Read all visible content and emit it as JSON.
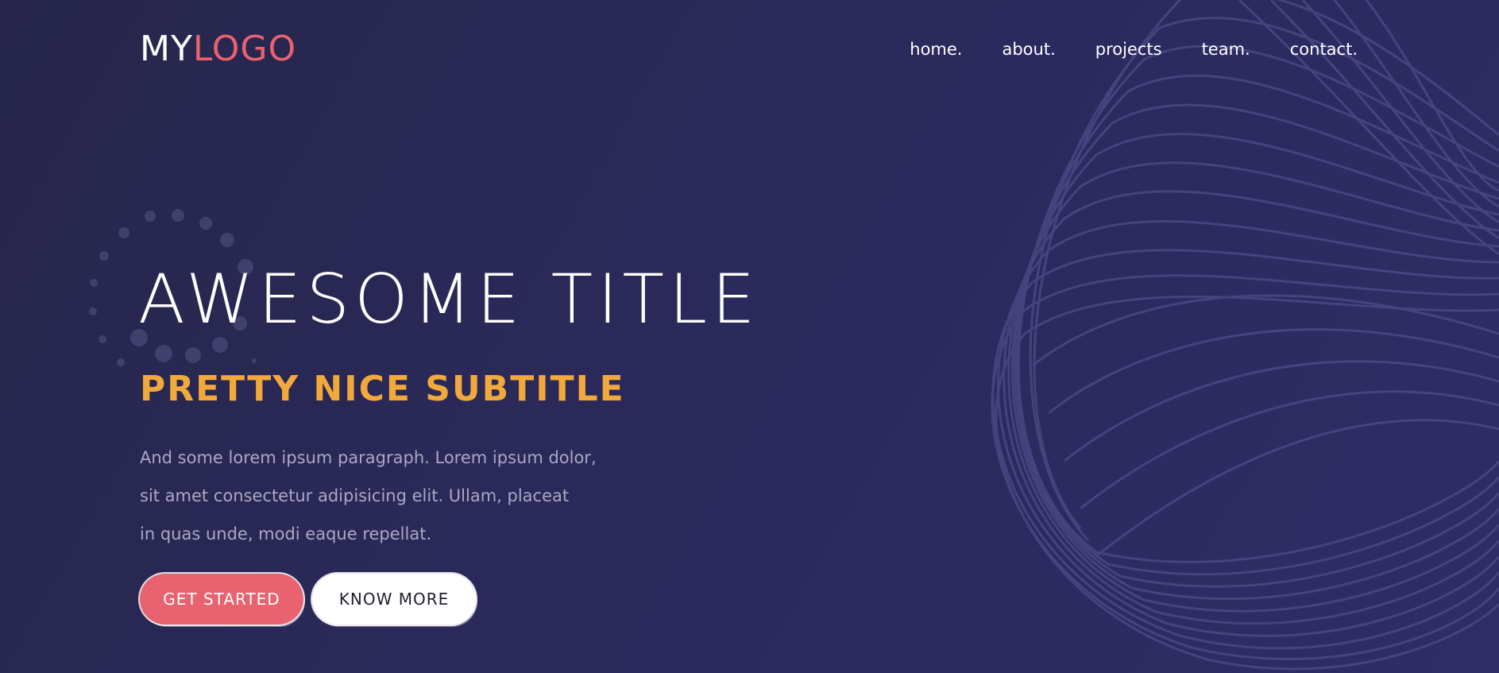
{
  "logo": {
    "part1": "MY",
    "part2": "LOGO"
  },
  "nav": [
    {
      "label": "home."
    },
    {
      "label": "about."
    },
    {
      "label": "projects"
    },
    {
      "label": "team."
    },
    {
      "label": "contact."
    }
  ],
  "hero": {
    "title": "AWESOME TITLE",
    "subtitle": "PRETTY NICE SUBTITLE",
    "paragraph_lines": [
      "And some lorem ipsum paragraph. Lorem ipsum dolor,",
      "sit amet consectetur adipisicing elit. Ullam, placeat",
      "in quas unde, modi eaque repellat."
    ],
    "primary_button": "GET STARTED",
    "secondary_button": "KNOW MORE"
  },
  "colors": {
    "background": "#2b2a5e",
    "accent_logo": "#e8626f",
    "subtitle": "#f2a93b",
    "paragraph": "#a9a8c4"
  }
}
